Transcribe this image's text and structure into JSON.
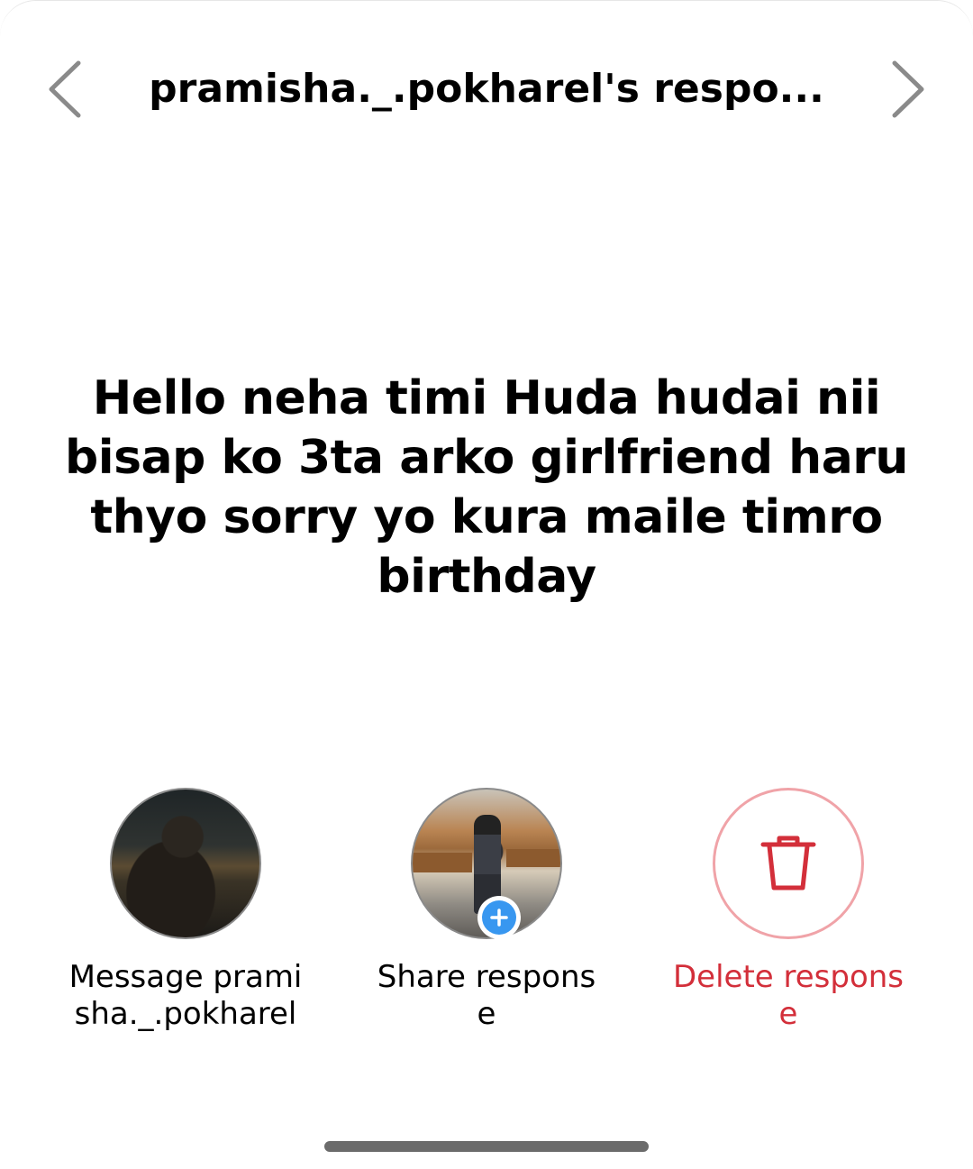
{
  "header": {
    "title": "pramisha._.pokharel's respo...",
    "prev_icon": "chevron-left-icon",
    "next_icon": "chevron-right-icon"
  },
  "response": {
    "text": "Hello neha timi Huda hudai nii bisap ko 3ta arko girlfriend haru thyo sorry yo kura maile timro birthday"
  },
  "actions": {
    "message": {
      "label": "Message pramisha._.pokharel",
      "avatar": "user-avatar"
    },
    "share": {
      "label": "Share response",
      "badge_icon": "plus-icon",
      "badge_color": "#3897f0"
    },
    "delete": {
      "label": "Delete response",
      "icon": "trash-icon",
      "color": "#d32f3a",
      "ring_color": "#f0a3a8"
    }
  }
}
